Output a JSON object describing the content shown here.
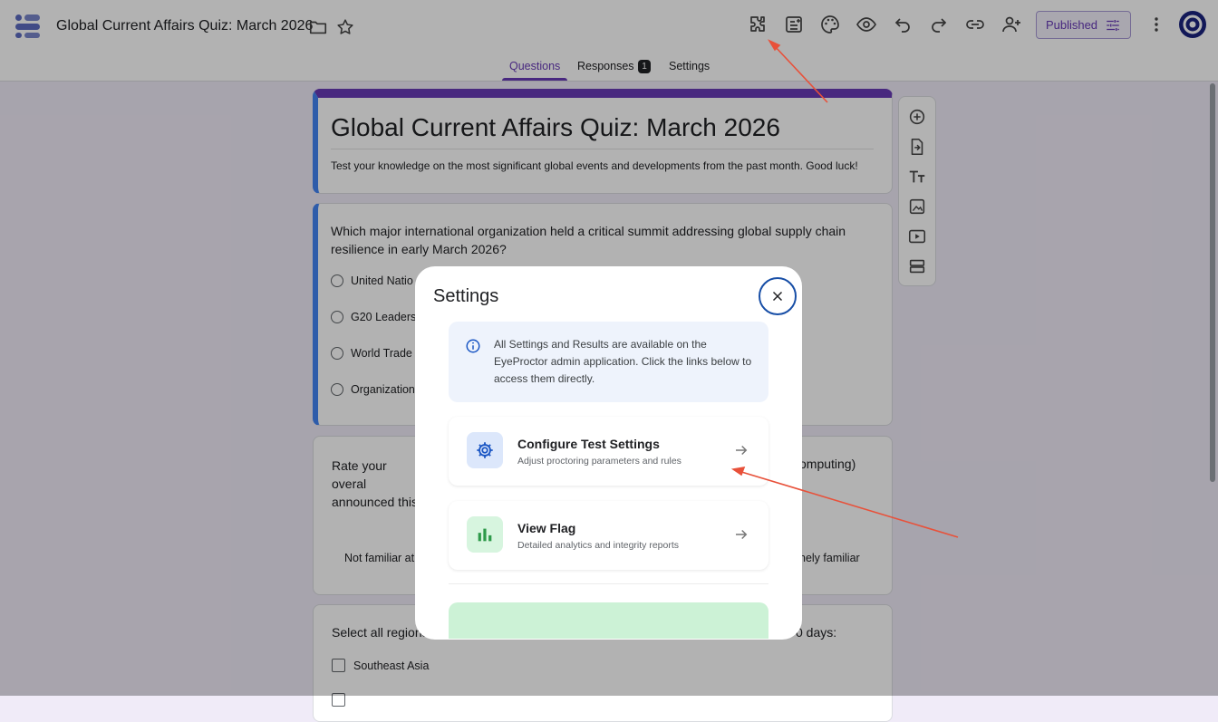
{
  "header": {
    "doc_title": "Global Current Affairs Quiz: March 2026",
    "published_label": "Published",
    "toolbar_icons": [
      "addons-icon",
      "customize-icon",
      "palette-icon",
      "preview-icon",
      "undo-icon",
      "redo-icon",
      "link-icon",
      "add-collaborator-icon"
    ]
  },
  "tabs": {
    "questions": "Questions",
    "responses": "Responses",
    "responses_count": "1",
    "settings": "Settings"
  },
  "form": {
    "title": "Global Current Affairs Quiz: March 2026",
    "description": "Test your knowledge on the most significant global events and developments from the past month. Good luck!",
    "q1": {
      "text": "Which major international organization held a critical summit addressing global supply chain resilience in early March 2026?",
      "options": [
        "United Natio",
        "G20 Leaders",
        "World Trade",
        "Organization"
      ]
    },
    "q2": {
      "text_left": "Rate your overal announced this",
      "text_right": "omputing)",
      "scale_left": "Not familiar at",
      "scale_right": "nely familiar"
    },
    "q3": {
      "text_left": "Select all regions",
      "text_right": "0 days:",
      "options": [
        "Southeast Asia"
      ]
    }
  },
  "modal": {
    "title": "Settings",
    "info": "All Settings and Results are available on the EyeProctor admin application. Click the links below to access them directly.",
    "rows": [
      {
        "title": "Configure Test Settings",
        "subtitle": "Adjust proctoring parameters and rules",
        "icon": "gear-icon"
      },
      {
        "title": "View Flag",
        "subtitle": "Detailed analytics and integrity reports",
        "icon": "bar-chart-icon"
      }
    ]
  },
  "colors": {
    "accent": "#673ab7",
    "annotation_arrow": "#e8513a",
    "close_ring": "#174ea6"
  }
}
